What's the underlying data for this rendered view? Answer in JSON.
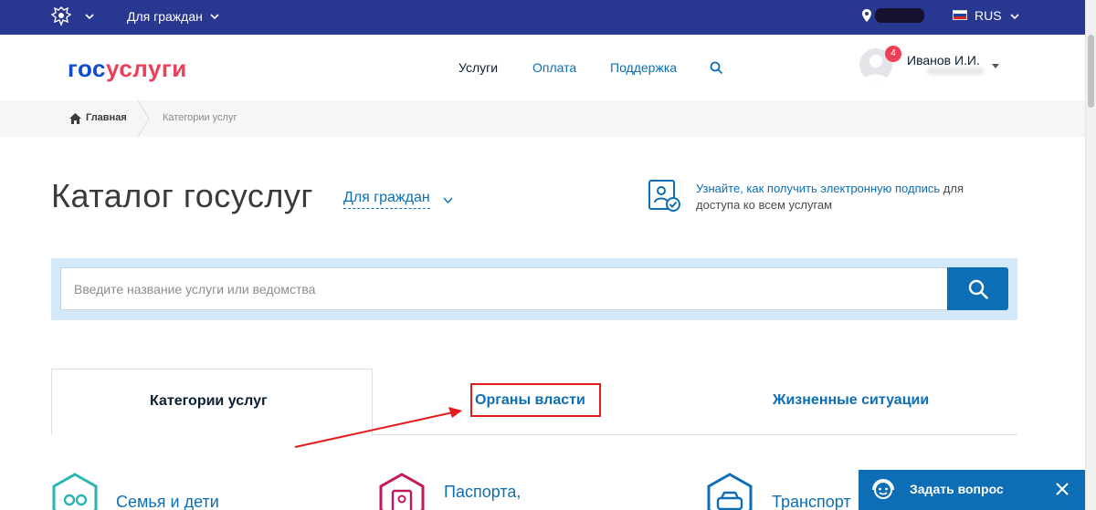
{
  "topbar": {
    "for_citizens": "Для граждан",
    "language": "RUS"
  },
  "header": {
    "logo_part1": "гос",
    "logo_part2": "услуги",
    "nav": {
      "services": "Услуги",
      "payment": "Оплата",
      "support": "Поддержка"
    },
    "user": {
      "name": "Иванов И.И.",
      "notifications": "4"
    }
  },
  "breadcrumb": {
    "home": "Главная",
    "current": "Категории услуг"
  },
  "main": {
    "title": "Каталог госуслуг",
    "audience": "Для граждан",
    "sign_promo_link": "Узнайте, как получить электронную подпись",
    "sign_promo_rest": " для доступа ко всем услугам",
    "search": {
      "placeholder": "Введите название услуги или ведомства"
    },
    "tabs": [
      {
        "label": "Категории услуг"
      },
      {
        "label": "Органы власти"
      },
      {
        "label": "Жизненные ситуации"
      }
    ],
    "categories": [
      {
        "label": "Семья и дети"
      },
      {
        "label": "Паспорта,"
      },
      {
        "label": "Транспорт"
      }
    ]
  },
  "chat": {
    "label": "Задать вопрос"
  },
  "colors": {
    "topbar": "#283891",
    "link": "#0d6eb5",
    "accent_red": "#ee3f58",
    "highlight": "#e31b1b",
    "family_icon": "#2ab5b3",
    "passport_icon": "#c2185b",
    "transport_icon": "#0d6eb5"
  }
}
